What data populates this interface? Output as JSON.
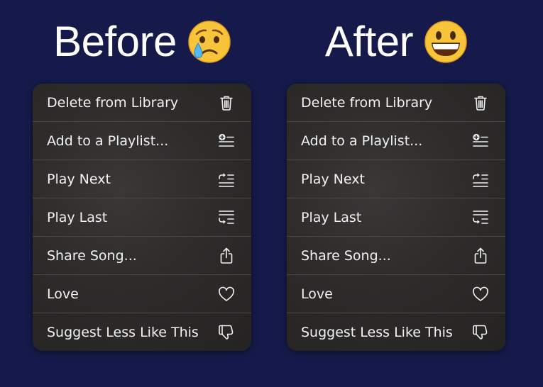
{
  "panels": [
    {
      "heading": "Before",
      "emoji": "crying-face",
      "items": [
        {
          "label": "Delete from Library",
          "icon": "trash-icon"
        },
        {
          "label": "Add to a Playlist...",
          "icon": "add-to-playlist-icon"
        },
        {
          "label": "Play Next",
          "icon": "play-next-icon"
        },
        {
          "label": "Play Last",
          "icon": "play-last-icon"
        },
        {
          "label": "Share Song...",
          "icon": "share-icon"
        },
        {
          "label": "Love",
          "icon": "heart-icon"
        },
        {
          "label": "Suggest Less Like This",
          "icon": "thumbs-down-icon"
        }
      ]
    },
    {
      "heading": "After",
      "emoji": "grinning-face",
      "items": [
        {
          "label": "Delete from Library",
          "icon": "trash-icon"
        },
        {
          "label": "Add to a Playlist...",
          "icon": "add-to-playlist-icon"
        },
        {
          "label": "Play Next",
          "icon": "play-next-icon"
        },
        {
          "label": "Play Last",
          "icon": "play-last-icon"
        },
        {
          "label": "Share Song...",
          "icon": "share-icon"
        },
        {
          "label": "Love",
          "icon": "heart-icon"
        },
        {
          "label": "Suggest Less Like This",
          "icon": "thumbs-down-icon"
        }
      ]
    }
  ],
  "colors": {
    "background": "#151a4a",
    "menu": "#2e2c2b",
    "text": "#f2f2f2",
    "divider": "#4a4847"
  }
}
